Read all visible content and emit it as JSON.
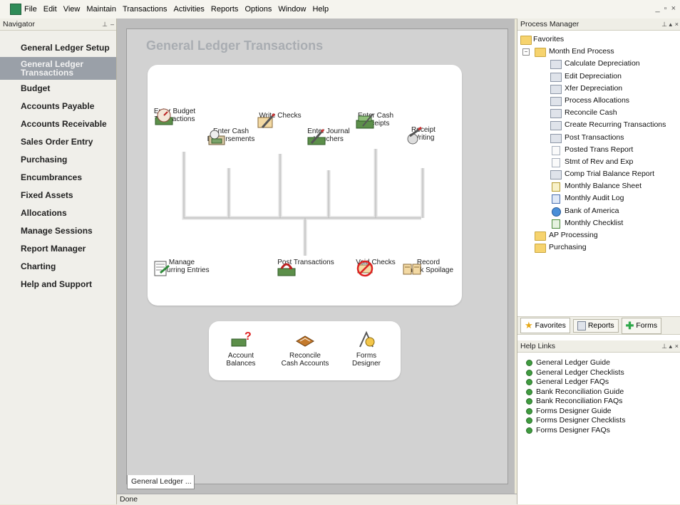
{
  "menubar": {
    "items": [
      "File",
      "Edit",
      "View",
      "Maintain",
      "Transactions",
      "Activities",
      "Reports",
      "Options",
      "Window",
      "Help"
    ],
    "window_controls": [
      "_",
      "▫",
      "×"
    ]
  },
  "navigator": {
    "title": "Navigator",
    "items": [
      {
        "label": "General Ledger Setup",
        "active": false
      },
      {
        "label": "General Ledger Transactions",
        "active": true
      },
      {
        "label": "Budget",
        "active": false
      },
      {
        "label": "Accounts Payable",
        "active": false
      },
      {
        "label": "Accounts Receivable",
        "active": false
      },
      {
        "label": "Sales Order Entry",
        "active": false
      },
      {
        "label": "Purchasing",
        "active": false
      },
      {
        "label": "Encumbrances",
        "active": false
      },
      {
        "label": "Fixed Assets",
        "active": false
      },
      {
        "label": "Allocations",
        "active": false
      },
      {
        "label": "Manage Sessions",
        "active": false
      },
      {
        "label": "Report Manager",
        "active": false
      },
      {
        "label": "Charting",
        "active": false
      },
      {
        "label": "Help and Support",
        "active": false
      }
    ]
  },
  "center": {
    "title": "General Ledger Transactions",
    "actions": [
      {
        "label": "Enter Budget\nTransactions",
        "icon": "budget-icon"
      },
      {
        "label": "Enter Cash\nDisbursements",
        "icon": "cash-disbursements-icon"
      },
      {
        "label": "Write Checks",
        "icon": "write-checks-icon"
      },
      {
        "label": "Enter Journal\nVouchers",
        "icon": "journal-vouchers-icon"
      },
      {
        "label": "Enter Cash\nReceipts",
        "icon": "cash-receipts-icon"
      },
      {
        "label": "Receipt\nWriting",
        "icon": "receipt-writing-icon"
      },
      {
        "label": "Manage\nRecurring Entries",
        "icon": "recurring-entries-icon"
      },
      {
        "label": "Post Transactions",
        "icon": "post-transactions-icon"
      },
      {
        "label": "Void Checks",
        "icon": "void-checks-icon"
      },
      {
        "label": "Record\nCheck Spoilage",
        "icon": "check-spoilage-icon"
      }
    ],
    "lower_actions": [
      {
        "label": "Account\nBalances",
        "icon": "account-balances-icon"
      },
      {
        "label": "Reconcile\nCash Accounts",
        "icon": "reconcile-cash-icon"
      },
      {
        "label": "Forms\nDesigner",
        "icon": "forms-designer-icon"
      }
    ],
    "doc_tab": "General Ledger ...",
    "status": "Done"
  },
  "process_manager": {
    "title": "Process Manager",
    "tree": [
      {
        "label": "Favorites",
        "level": 0,
        "type": "folder"
      },
      {
        "label": "Month End Process",
        "level": 1,
        "type": "folder",
        "expander": "−"
      },
      {
        "label": "Calculate Depreciation",
        "level": 2,
        "type": "doc"
      },
      {
        "label": "Edit Depreciation",
        "level": 2,
        "type": "doc"
      },
      {
        "label": "Xfer Depreciation",
        "level": 2,
        "type": "doc"
      },
      {
        "label": "Process Allocations",
        "level": 2,
        "type": "doc"
      },
      {
        "label": "Reconcile Cash",
        "level": 2,
        "type": "doc"
      },
      {
        "label": "Create Recurring Transactions",
        "level": 2,
        "type": "doc"
      },
      {
        "label": "Post Transactions",
        "level": 2,
        "type": "doc"
      },
      {
        "label": "Posted Trans Report",
        "level": 2,
        "type": "page"
      },
      {
        "label": "Stmt of Rev and Exp",
        "level": 2,
        "type": "page"
      },
      {
        "label": "Comp Trial Balance Report",
        "level": 2,
        "type": "doc"
      },
      {
        "label": "Monthly Balance Sheet",
        "level": 2,
        "type": "page"
      },
      {
        "label": "Monthly Audit Log",
        "level": 2,
        "type": "page"
      },
      {
        "label": "Bank of America",
        "level": 2,
        "type": "page"
      },
      {
        "label": "Monthly Checklist",
        "level": 2,
        "type": "page"
      },
      {
        "label": "AP Processing",
        "level": 1,
        "type": "folder"
      },
      {
        "label": "Purchasing",
        "level": 1,
        "type": "folder"
      }
    ],
    "tabs": [
      {
        "label": "Favorites",
        "icon": "star-icon",
        "active": true
      },
      {
        "label": "Reports",
        "icon": "report-icon",
        "active": false
      },
      {
        "label": "Forms",
        "icon": "plus-icon",
        "active": false
      }
    ]
  },
  "help_links": {
    "title": "Help Links",
    "items": [
      "General Ledger Guide",
      "General Ledger Checklists",
      "General Ledger FAQs",
      "Bank Reconciliation Guide",
      "Bank Reconciliation FAQs",
      "Forms Designer Guide",
      "Forms Designer Checklists",
      "Forms Designer FAQs"
    ]
  }
}
